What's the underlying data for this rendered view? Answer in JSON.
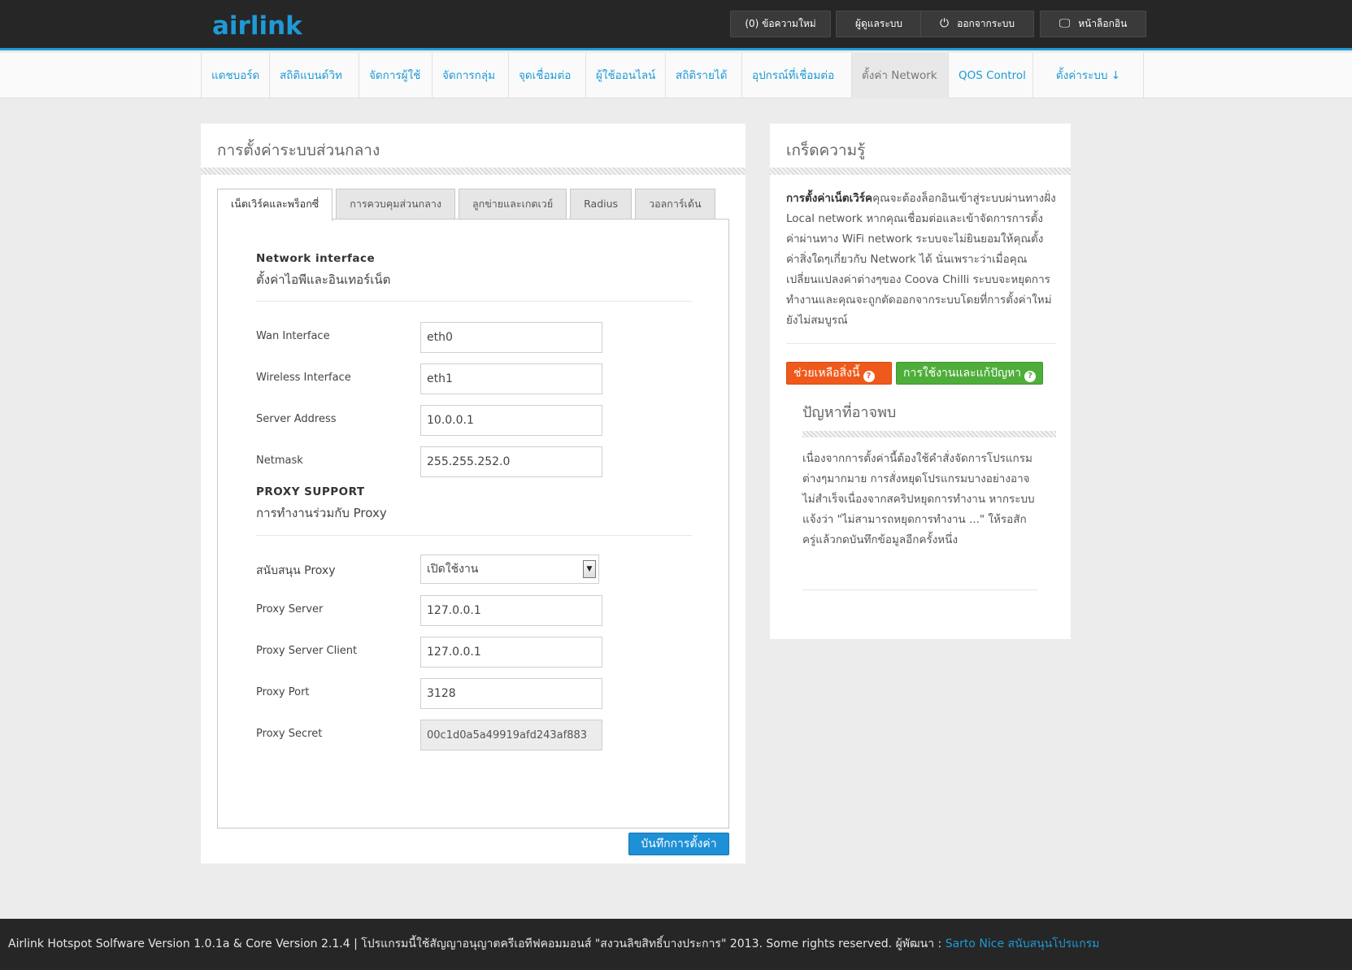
{
  "app": {
    "logo": "airlink"
  },
  "topbar": {
    "messages": "(0) ข้อความใหม่",
    "admin": "ผู้ดูแลระบบ",
    "logout": "ออกจากระบบ",
    "login_page": "หน้าล็อกอิน"
  },
  "nav": [
    {
      "label": "แดชบอร์ด"
    },
    {
      "label": "สถิติแบนด์วิท"
    },
    {
      "label": "จัดการผู้ใช้"
    },
    {
      "label": "จัดการกลุ่ม"
    },
    {
      "label": "จุดเชื่อมต่อ"
    },
    {
      "label": "ผู้ใช้ออนไลน์"
    },
    {
      "label": "สถิติรายได้"
    },
    {
      "label": "อุปกรณ์ที่เชื่อมต่อ"
    },
    {
      "label": "ตั้งค่า Network",
      "active": true
    },
    {
      "label": "QOS Control"
    },
    {
      "label": "ตั้งค่าระบบ ↓"
    }
  ],
  "main": {
    "title": "การตั้งค่าระบบส่วนกลาง",
    "tabs": [
      {
        "label": "เน็ตเวิร์คและพร็อกซี่",
        "active": true
      },
      {
        "label": "การควบคุมส่วนกลาง"
      },
      {
        "label": "ลูกข่ายและเกตเวย์"
      },
      {
        "label": "Radius"
      },
      {
        "label": "วอลการ์เด้น"
      }
    ],
    "network_section": {
      "title": "Network interface",
      "subtitle": "ตั้งค่าไอพีและอินเทอร์เน็ต"
    },
    "network_fields": {
      "wan_label": "Wan Interface",
      "wan_value": "eth0",
      "wireless_label": "Wireless Interface",
      "wireless_value": "eth1",
      "server_label": "Server Address",
      "server_value": "10.0.0.1",
      "netmask_label": "Netmask",
      "netmask_value": "255.255.252.0"
    },
    "proxy_section": {
      "title": "PROXY SUPPORT",
      "subtitle": "การทำงานร่วมกับ Proxy"
    },
    "proxy_fields": {
      "support_label": "สนับสนุน Proxy",
      "support_value": "เปิดใช้งาน",
      "server_label": "Proxy Server",
      "server_value": "127.0.0.1",
      "client_label": "Proxy Server Client",
      "client_value": "127.0.0.1",
      "port_label": "Proxy Port",
      "port_value": "3128",
      "secret_label": "Proxy Secret",
      "secret_value": "00c1d0a5a49919afd243af883"
    },
    "save_label": "บันทึกการตั้งค่า"
  },
  "side": {
    "title": "เกร็ดความรู้",
    "tip_bold": "การตั้งค่าเน็ตเวิร์ค",
    "tip_text": "คุณจะต้องล็อกอินเข้าสู่ระบบผ่านทางฝั่ง Local network หากคุณเชื่อมต่อและเข้าจัดการการตั้งค่าผ่านทาง WiFi network ระบบจะไม่ยินยอมให้คุณตั้งค่าสิ่งใดๆเกี่ยวกับ Network ได้ นั่นเพราะว่าเมื่อคุณเปลี่ยนแปลงค่าต่างๆของ Coova Chilli ระบบจะหยุดการทำงานและคุณจะถูกตัดออกจากระบบโดยที่การตั้งค่าใหม่ยังไม่สมบูรณ์",
    "help_label": "ช่วยเหลือสิ่งนี้",
    "guide_label": "การใช้งานและแก้ปัญหา",
    "problem_title": "ปัญหาที่อาจพบ",
    "problem_text": "เนื่องจากการตั้งค่านี้ต้องใช้คำสั่งจัดการโปรแกรมต่างๆมากมาย การสั่งหยุดโปรแกรมบางอย่างอาจไม่สำเร็จเนื่องจากสคริปหยุดการทำงาน หากระบบแจ้งว่า \"ไม่สามารถหยุดการทำงาน ...\" ให้รอสักครู่แล้วกดบันทึกข้อมูลอีกครั้งหนึ่ง"
  },
  "footer": {
    "text": "Airlink Hotspot Solfware Version 1.0.1a & Core Version 2.1.4 | โปรแกรมนี้ใช้สัญญาอนุญาตครีเอทีฟคอมมอนส์ \"สงวนลิขสิทธิ์บางประการ\" 2013. Some rights reserved. ผู้พัฒนา : ",
    "link": "Sarto Nice สนับสนุนโปรแกรม"
  }
}
